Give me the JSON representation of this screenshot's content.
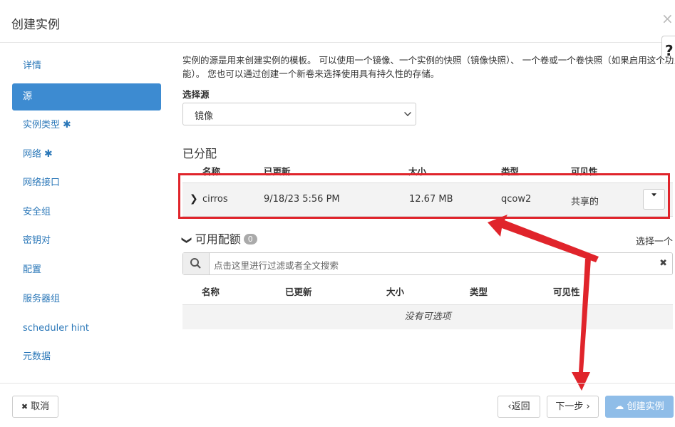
{
  "modal": {
    "title": "创建实例",
    "close_symbol": "×",
    "help_symbol": "?"
  },
  "sidebar": {
    "items": [
      {
        "label": "详情",
        "required": false,
        "active": false
      },
      {
        "label": "源",
        "required": false,
        "active": true
      },
      {
        "label": "实例类型",
        "required": true,
        "active": false
      },
      {
        "label": "网络",
        "required": true,
        "active": false
      },
      {
        "label": "网络接口",
        "required": false,
        "active": false
      },
      {
        "label": "安全组",
        "required": false,
        "active": false
      },
      {
        "label": "密钥对",
        "required": false,
        "active": false
      },
      {
        "label": "配置",
        "required": false,
        "active": false
      },
      {
        "label": "服务器组",
        "required": false,
        "active": false
      },
      {
        "label": "scheduler hint",
        "required": false,
        "active": false
      },
      {
        "label": "元数据",
        "required": false,
        "active": false
      }
    ],
    "required_mark": "✱"
  },
  "source": {
    "description": "实例的源是用来创建实例的模板。 可以使用一个镜像、一个实例的快照（镜像快照）、 一个卷或一个卷快照（如果启用这个功能）。 您也可以通过创建一个新卷来选择使用具有持久性的存储。",
    "select_label": "选择源",
    "select_value": "镜像"
  },
  "allocated": {
    "title": "已分配",
    "columns": [
      "名称",
      "已更新",
      "大小",
      "类型",
      "可见性"
    ],
    "rows": [
      {
        "name": "cirros",
        "updated": "9/18/23 5:56 PM",
        "size": "12.67 MB",
        "type": "qcow2",
        "visibility": "共享的"
      }
    ]
  },
  "available": {
    "title": "可用配额",
    "count": "0",
    "select_one": "选择一个",
    "search_placeholder": "点击这里进行过滤或者全文搜索",
    "columns": [
      "名称",
      "已更新",
      "大小",
      "类型",
      "可见性"
    ],
    "empty_text": "没有可选项"
  },
  "footer": {
    "cancel_label": "取消",
    "back_label": "返回",
    "next_label": "下一步",
    "create_label": "创建实例"
  },
  "colors": {
    "active_nav": "#3d8bd1",
    "annotation_red": "#e0242b",
    "primary_button": "#8fbde8"
  }
}
